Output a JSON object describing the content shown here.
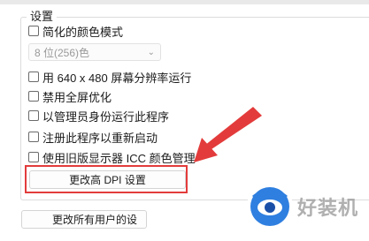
{
  "settings": {
    "title": "设置",
    "options": [
      {
        "label": "简化的颜色模式",
        "checked": false
      },
      {
        "label": "用 640 x 480 屏幕分辨率运行",
        "checked": false
      },
      {
        "label": "禁用全屏优化",
        "checked": false
      },
      {
        "label": "以管理员身份运行此程序",
        "checked": false
      },
      {
        "label": "注册此程序以重新启动",
        "checked": false
      },
      {
        "label": "使用旧版显示器 ICC 颜色管理",
        "checked": false
      }
    ],
    "color_depth": {
      "value": "8 位(256)色"
    },
    "dpi_button": "更改高 DPI 设置",
    "all_users_button": "更改所有用户的设"
  },
  "annotation": {
    "color": "#e33b3b"
  },
  "watermark": {
    "text": "好装机",
    "icon": "eye-logo-icon"
  }
}
